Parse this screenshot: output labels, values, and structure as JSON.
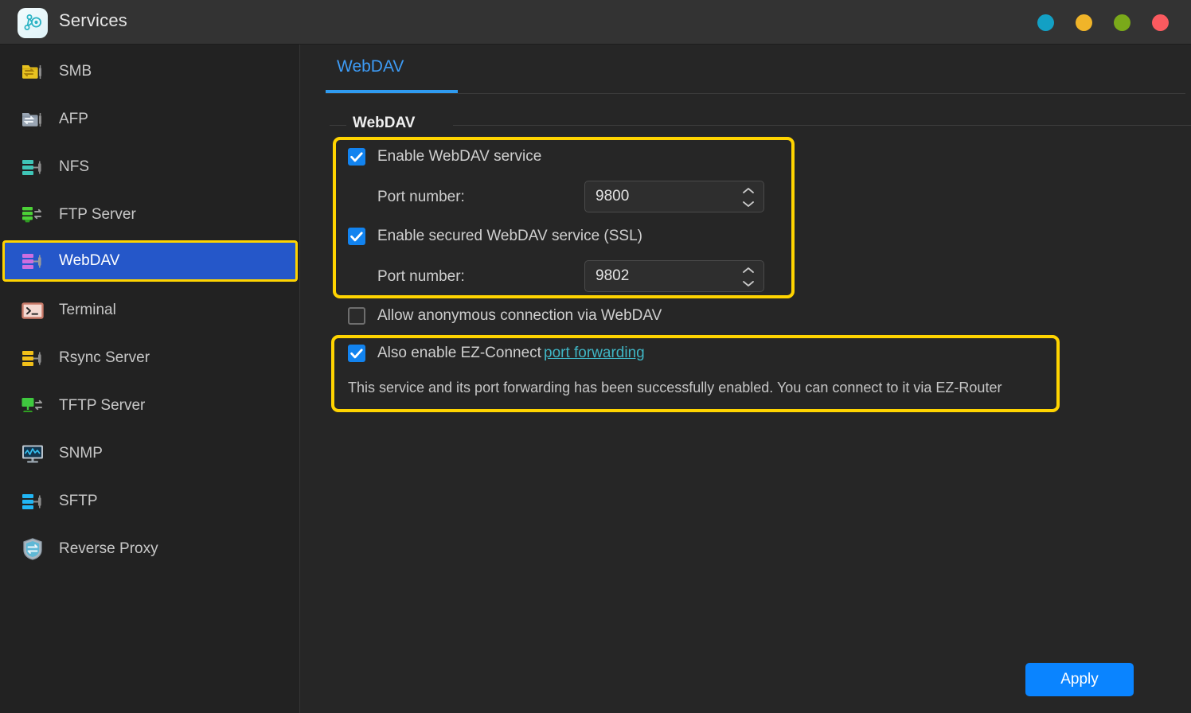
{
  "window": {
    "title": "Services",
    "app_icon": "services-node-graph-icon",
    "controls": [
      {
        "name": "window-button-teal",
        "color": "#13a0c4"
      },
      {
        "name": "window-button-yellow",
        "color": "#f0b429"
      },
      {
        "name": "window-button-green",
        "color": "#7aa91a"
      },
      {
        "name": "window-button-red",
        "color": "#fa5a5f"
      }
    ]
  },
  "sidebar": {
    "items": [
      {
        "label": "SMB",
        "icon": "smb-folder-share-icon",
        "selected": false
      },
      {
        "label": "AFP",
        "icon": "afp-folder-share-icon",
        "selected": false
      },
      {
        "label": "NFS",
        "icon": "nfs-server-icon",
        "selected": false
      },
      {
        "label": "FTP Server",
        "icon": "ftp-server-icon",
        "selected": false
      },
      {
        "label": "WebDAV",
        "icon": "webdav-server-icon",
        "selected": true
      },
      {
        "label": "Terminal",
        "icon": "terminal-icon",
        "selected": false
      },
      {
        "label": "Rsync Server",
        "icon": "rsync-server-icon",
        "selected": false
      },
      {
        "label": "TFTP Server",
        "icon": "tftp-server-icon",
        "selected": false
      },
      {
        "label": "SNMP",
        "icon": "snmp-monitor-icon",
        "selected": false
      },
      {
        "label": "SFTP",
        "icon": "sftp-server-icon",
        "selected": false
      },
      {
        "label": "Reverse Proxy",
        "icon": "reverse-proxy-shield-icon",
        "selected": false
      }
    ]
  },
  "main": {
    "tab": {
      "label": "WebDAV",
      "active": true
    },
    "group_title": "WebDAV",
    "enable_service": {
      "label": "Enable WebDAV service",
      "checked": true
    },
    "port1": {
      "label": "Port number:",
      "value": "9800"
    },
    "enable_ssl": {
      "label": "Enable secured WebDAV service (SSL)",
      "checked": true
    },
    "port2": {
      "label": "Port number:",
      "value": "9802"
    },
    "allow_anonymous": {
      "label": "Allow anonymous connection via WebDAV",
      "checked": false
    },
    "ez_connect": {
      "label": "Also enable EZ-Connect",
      "link_text": "port forwarding",
      "checked": true,
      "status": "This service and its port forwarding has been successfully enabled. You can connect to it via EZ-Router"
    },
    "apply_label": "Apply"
  },
  "colors": {
    "accent_blue": "#0a84ff",
    "tab_blue": "#3d9bf5",
    "highlight_yellow": "#ffd400",
    "selection_blue": "#2557c9",
    "link_teal": "#3fb5c4"
  }
}
